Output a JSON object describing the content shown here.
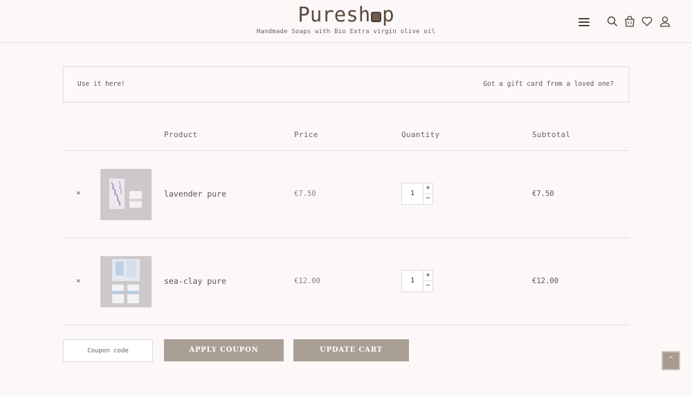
{
  "header": {
    "logo_prefix": "Pures",
    "logo_middle": "h",
    "logo_suffix": "p",
    "tagline": "Handmade Soaps with Bio Extra virgin olive oil",
    "icons": [
      "menu-icon",
      "search-icon",
      "cart-icon",
      "heart-icon",
      "user-icon"
    ]
  },
  "gift_card": {
    "left_text": "Use it here!",
    "right_text": "Got a gift card from a loved one?"
  },
  "table": {
    "headers": {
      "product": "Product",
      "price": "Price",
      "quantity": "Quantity",
      "subtotal": "Subtotal"
    },
    "rows": [
      {
        "remove": "×",
        "name": "lavender pure",
        "price": "€7.50",
        "quantity": "1",
        "plus": "+",
        "minus": "−",
        "subtotal": "€7.50"
      },
      {
        "remove": "×",
        "name": "sea-clay pure",
        "price": "€12.00",
        "quantity": "1",
        "plus": "+",
        "minus": "−",
        "subtotal": "€12.00"
      }
    ]
  },
  "actions": {
    "coupon_placeholder": "Coupon code",
    "apply_label": "APPLY COUPON",
    "update_label": "UPDATE CART",
    "to_top": "^"
  },
  "colors": {
    "background": "#fcf8f8",
    "button": "#aa9f94",
    "logo": "#5a4a3e"
  }
}
